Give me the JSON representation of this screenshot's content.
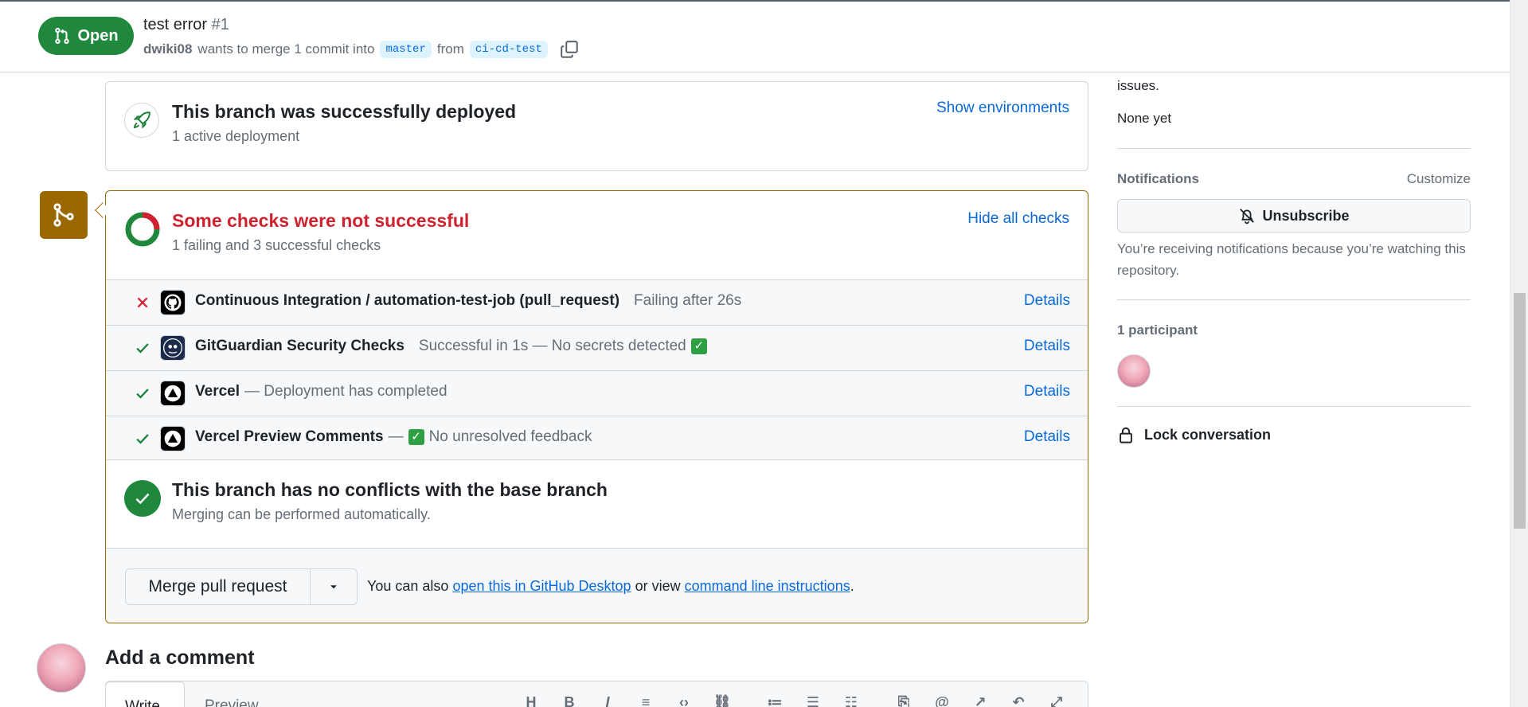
{
  "header": {
    "state": "Open",
    "title": "test error",
    "number": "#1",
    "author": "dwiki08",
    "merge_text": "wants to merge 1 commit into",
    "base_branch": "master",
    "from_text": "from",
    "head_branch": "ci-cd-test"
  },
  "deployment": {
    "title": "This branch was successfully deployed",
    "subtitle": "1 active deployment",
    "link": "Show environments"
  },
  "checks": {
    "title": "Some checks were not successful",
    "subtitle": "1 failing and 3 successful checks",
    "toggle": "Hide all checks",
    "title_color": "#cf222e",
    "items": [
      {
        "status": "failing",
        "app": "github-actions-icon",
        "name": "Continuous Integration / automation-test-job (pull_request)",
        "description": "Failing after 26s",
        "details": "Details"
      },
      {
        "status": "success",
        "app": "gitguardian-icon",
        "name": "GitGuardian Security Checks",
        "description": "Successful in 1s — No secrets detected",
        "details": "Details"
      },
      {
        "status": "success",
        "app": "vercel-icon",
        "name": "Vercel",
        "description": "— Deployment has completed",
        "details": "Details"
      },
      {
        "status": "success",
        "app": "vercel-icon",
        "name": "Vercel Preview Comments",
        "description_prefix": "—",
        "description": "No unresolved feedback",
        "details": "Details"
      }
    ]
  },
  "conflicts": {
    "title": "This branch has no conflicts with the base branch",
    "subtitle": "Merging can be performed automatically."
  },
  "merge": {
    "button": "Merge pull request",
    "note_prefix": "You can also",
    "desktop_link": "open this in GitHub Desktop",
    "note_middle": "or view",
    "cli_link": "command line instructions",
    "note_suffix": "."
  },
  "comment": {
    "heading": "Add a comment",
    "tab_write": "Write",
    "tab_preview": "Preview"
  },
  "sidebar": {
    "issues_tail": "issues.",
    "none_yet": "None yet",
    "notifications_label": "Notifications",
    "customize": "Customize",
    "unsubscribe": "Unsubscribe",
    "notice": "You’re receiving notifications because you’re watching this repository.",
    "participants": "1 participant",
    "lock": "Lock conversation"
  },
  "colors": {
    "open_green": "#1f883d",
    "merge_warning": "#9a6700",
    "link_blue": "#0969da"
  }
}
